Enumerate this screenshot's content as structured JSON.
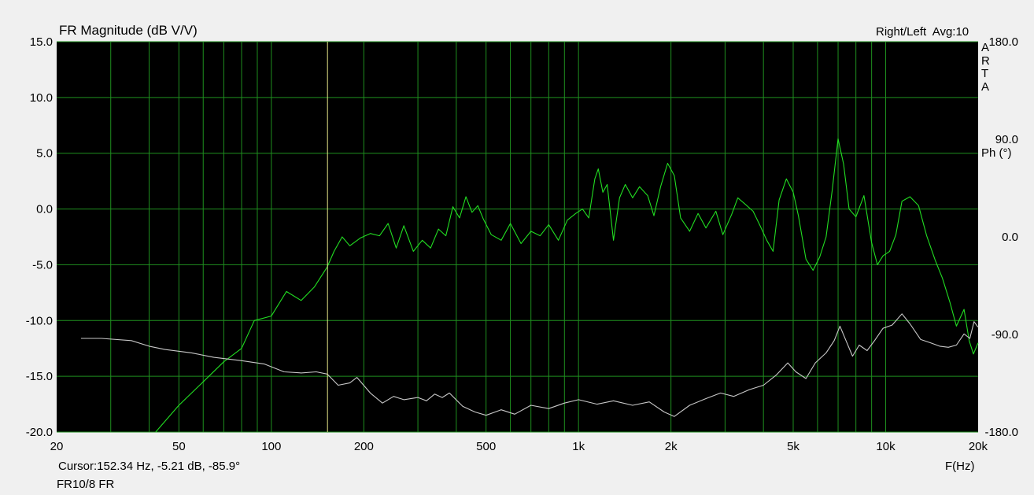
{
  "header": {
    "title": "FR Magnitude (dB V/V)",
    "channel_info": "Right/Left  Avg:10",
    "brand_letters": [
      "A",
      "R",
      "T",
      "A"
    ],
    "right_axis_label": "Ph (°)"
  },
  "footer": {
    "cursor_readout": "Cursor:152.34 Hz, -5.21 dB, -85.9°",
    "file_name": "FR10/8 FR",
    "x_axis_label": "F(Hz)"
  },
  "chart_data": {
    "type": "line",
    "title": "FR Magnitude (dB V/V)",
    "xlabel": "F(Hz)",
    "ylabel": "",
    "y2label": "Ph (°)",
    "xscale": "log",
    "xlim": [
      20,
      20000
    ],
    "ylim": [
      -20,
      15
    ],
    "y2lim": [
      -180,
      180
    ],
    "grid": true,
    "background": "#000000",
    "x_ticks": [
      {
        "value": 20,
        "label": "20"
      },
      {
        "value": 50,
        "label": "50"
      },
      {
        "value": 100,
        "label": "100"
      },
      {
        "value": 200,
        "label": "200"
      },
      {
        "value": 500,
        "label": "500"
      },
      {
        "value": 1000,
        "label": "1k"
      },
      {
        "value": 2000,
        "label": "2k"
      },
      {
        "value": 5000,
        "label": "5k"
      },
      {
        "value": 10000,
        "label": "10k"
      },
      {
        "value": 20000,
        "label": "20k"
      }
    ],
    "y_ticks": [
      {
        "value": 15,
        "label": "15.0"
      },
      {
        "value": 10,
        "label": "10.0"
      },
      {
        "value": 5,
        "label": "5.0"
      },
      {
        "value": 0,
        "label": "0.0"
      },
      {
        "value": -5,
        "label": "-5.0"
      },
      {
        "value": -10,
        "label": "-10.0"
      },
      {
        "value": -15,
        "label": "-15.0"
      },
      {
        "value": -20,
        "label": "-20.0"
      }
    ],
    "y2_ticks": [
      {
        "value": 180,
        "label": "180.0"
      },
      {
        "value": 90,
        "label": "90.0"
      },
      {
        "value": 0,
        "label": "0.0"
      },
      {
        "value": -90,
        "label": "-90.0"
      },
      {
        "value": -180,
        "label": "-180.0"
      }
    ],
    "cursor": {
      "x": 152.34,
      "magnitude_db": -5.21,
      "phase_deg": -85.9,
      "color": "#e8e88a"
    },
    "series": [
      {
        "color": "#22dd22",
        "axis": "left",
        "points": [
          [
            42,
            -20
          ],
          [
            50,
            -17.6
          ],
          [
            60,
            -15.5
          ],
          [
            70,
            -13.7
          ],
          [
            80,
            -12.5
          ],
          [
            88,
            -10
          ],
          [
            100,
            -9.6
          ],
          [
            112,
            -7.4
          ],
          [
            125,
            -8.2
          ],
          [
            138,
            -7.0
          ],
          [
            152,
            -5.2
          ],
          [
            160,
            -3.8
          ],
          [
            170,
            -2.5
          ],
          [
            180,
            -3.3
          ],
          [
            195,
            -2.6
          ],
          [
            210,
            -2.2
          ],
          [
            225,
            -2.4
          ],
          [
            240,
            -1.3
          ],
          [
            255,
            -3.5
          ],
          [
            270,
            -1.5
          ],
          [
            290,
            -3.8
          ],
          [
            310,
            -2.8
          ],
          [
            330,
            -3.5
          ],
          [
            350,
            -1.8
          ],
          [
            370,
            -2.4
          ],
          [
            390,
            0.2
          ],
          [
            410,
            -0.8
          ],
          [
            430,
            1.1
          ],
          [
            450,
            -0.3
          ],
          [
            470,
            0.3
          ],
          [
            490,
            -0.9
          ],
          [
            520,
            -2.3
          ],
          [
            560,
            -2.8
          ],
          [
            600,
            -1.3
          ],
          [
            650,
            -3.1
          ],
          [
            700,
            -2.0
          ],
          [
            750,
            -2.4
          ],
          [
            800,
            -1.4
          ],
          [
            860,
            -2.8
          ],
          [
            920,
            -1.0
          ],
          [
            980,
            -0.4
          ],
          [
            1030,
            0.0
          ],
          [
            1080,
            -0.8
          ],
          [
            1130,
            2.7
          ],
          [
            1160,
            3.6
          ],
          [
            1200,
            1.5
          ],
          [
            1240,
            2.2
          ],
          [
            1300,
            -2.8
          ],
          [
            1360,
            1.0
          ],
          [
            1420,
            2.2
          ],
          [
            1500,
            1.0
          ],
          [
            1580,
            2.0
          ],
          [
            1680,
            1.2
          ],
          [
            1760,
            -0.6
          ],
          [
            1850,
            2.0
          ],
          [
            1950,
            4.1
          ],
          [
            2050,
            3.0
          ],
          [
            2150,
            -0.8
          ],
          [
            2300,
            -2.0
          ],
          [
            2450,
            -0.4
          ],
          [
            2600,
            -1.7
          ],
          [
            2800,
            -0.2
          ],
          [
            2950,
            -2.3
          ],
          [
            3150,
            -0.5
          ],
          [
            3300,
            1.0
          ],
          [
            3500,
            0.4
          ],
          [
            3700,
            -0.2
          ],
          [
            3900,
            -1.5
          ],
          [
            4100,
            -2.8
          ],
          [
            4300,
            -3.8
          ],
          [
            4500,
            0.8
          ],
          [
            4750,
            2.7
          ],
          [
            5000,
            1.5
          ],
          [
            5200,
            -0.6
          ],
          [
            5500,
            -4.5
          ],
          [
            5800,
            -5.5
          ],
          [
            6100,
            -4.3
          ],
          [
            6400,
            -2.5
          ],
          [
            6700,
            1.7
          ],
          [
            7000,
            6.3
          ],
          [
            7300,
            4.0
          ],
          [
            7600,
            0.0
          ],
          [
            8000,
            -0.7
          ],
          [
            8500,
            1.2
          ],
          [
            9000,
            -3.0
          ],
          [
            9400,
            -5.0
          ],
          [
            9800,
            -4.2
          ],
          [
            10300,
            -3.8
          ],
          [
            10800,
            -2.3
          ],
          [
            11300,
            0.7
          ],
          [
            12000,
            1.1
          ],
          [
            12800,
            0.3
          ],
          [
            13600,
            -2.4
          ],
          [
            14500,
            -4.6
          ],
          [
            15300,
            -6.2
          ],
          [
            16200,
            -8.4
          ],
          [
            17000,
            -10.5
          ],
          [
            18000,
            -9.0
          ],
          [
            18700,
            -11.8
          ],
          [
            19300,
            -13.0
          ],
          [
            20000,
            -12.0
          ]
        ]
      },
      {
        "color": "#c8c8c8",
        "axis": "left",
        "points": [
          [
            24,
            -11.6
          ],
          [
            28,
            -11.6
          ],
          [
            35,
            -11.8
          ],
          [
            40,
            -12.3
          ],
          [
            45,
            -12.6
          ],
          [
            55,
            -12.9
          ],
          [
            65,
            -13.3
          ],
          [
            80,
            -13.6
          ],
          [
            95,
            -13.9
          ],
          [
            110,
            -14.6
          ],
          [
            125,
            -14.7
          ],
          [
            140,
            -14.6
          ],
          [
            152,
            -14.8
          ],
          [
            165,
            -15.8
          ],
          [
            180,
            -15.6
          ],
          [
            190,
            -15.1
          ],
          [
            210,
            -16.5
          ],
          [
            230,
            -17.4
          ],
          [
            250,
            -16.8
          ],
          [
            270,
            -17.1
          ],
          [
            300,
            -16.9
          ],
          [
            320,
            -17.2
          ],
          [
            340,
            -16.6
          ],
          [
            360,
            -16.9
          ],
          [
            380,
            -16.5
          ],
          [
            420,
            -17.7
          ],
          [
            460,
            -18.2
          ],
          [
            500,
            -18.5
          ],
          [
            560,
            -18.0
          ],
          [
            620,
            -18.4
          ],
          [
            700,
            -17.6
          ],
          [
            800,
            -17.9
          ],
          [
            900,
            -17.4
          ],
          [
            1000,
            -17.1
          ],
          [
            1150,
            -17.5
          ],
          [
            1300,
            -17.2
          ],
          [
            1500,
            -17.6
          ],
          [
            1700,
            -17.3
          ],
          [
            1900,
            -18.2
          ],
          [
            2050,
            -18.6
          ],
          [
            2300,
            -17.6
          ],
          [
            2600,
            -17.0
          ],
          [
            2900,
            -16.5
          ],
          [
            3200,
            -16.8
          ],
          [
            3600,
            -16.2
          ],
          [
            4000,
            -15.8
          ],
          [
            4400,
            -14.9
          ],
          [
            4800,
            -13.8
          ],
          [
            5100,
            -14.6
          ],
          [
            5500,
            -15.2
          ],
          [
            5900,
            -13.8
          ],
          [
            6400,
            -12.9
          ],
          [
            6800,
            -11.8
          ],
          [
            7100,
            -10.5
          ],
          [
            7400,
            -11.7
          ],
          [
            7800,
            -13.2
          ],
          [
            8200,
            -12.2
          ],
          [
            8700,
            -12.7
          ],
          [
            9200,
            -11.8
          ],
          [
            9800,
            -10.7
          ],
          [
            10500,
            -10.4
          ],
          [
            11300,
            -9.4
          ],
          [
            12000,
            -10.3
          ],
          [
            13000,
            -11.7
          ],
          [
            14000,
            -12.0
          ],
          [
            15000,
            -12.3
          ],
          [
            16000,
            -12.4
          ],
          [
            17000,
            -12.2
          ],
          [
            18000,
            -11.2
          ],
          [
            18800,
            -11.6
          ],
          [
            19400,
            -10.1
          ],
          [
            20000,
            -10.6
          ]
        ]
      }
    ]
  }
}
